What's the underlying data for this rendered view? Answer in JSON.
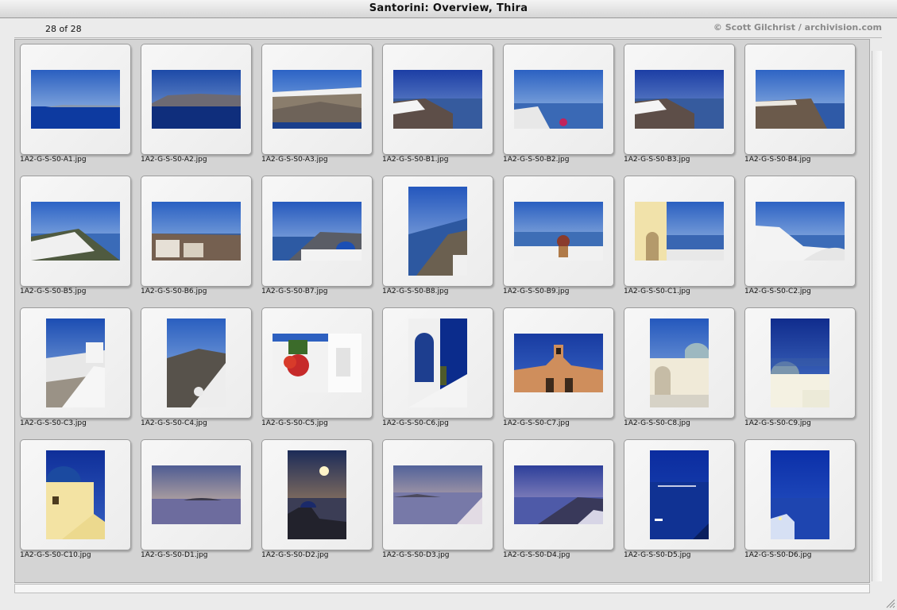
{
  "window": {
    "title": "Santorini: Overview, Thira",
    "counter": "28 of 28",
    "copyright": "© Scott Gilchrist / archivision.com"
  },
  "thumbnails": [
    {
      "filename": "1A2-G-S-S0-A1.jpg",
      "orientation": "landscape",
      "scene": "sea-horizon-island"
    },
    {
      "filename": "1A2-G-S-S0-A2.jpg",
      "orientation": "landscape",
      "scene": "caldera-cliffs-distant"
    },
    {
      "filename": "1A2-G-S-S0-A3.jpg",
      "orientation": "landscape",
      "scene": "town-on-cliff"
    },
    {
      "filename": "1A2-G-S-S0-B1.jpg",
      "orientation": "landscape",
      "scene": "village-caldera-view"
    },
    {
      "filename": "1A2-G-S-S0-B2.jpg",
      "orientation": "landscape",
      "scene": "terrace-flowers-sea"
    },
    {
      "filename": "1A2-G-S-S0-B3.jpg",
      "orientation": "landscape",
      "scene": "village-deep-blue-sky"
    },
    {
      "filename": "1A2-G-S-S0-B4.jpg",
      "orientation": "landscape",
      "scene": "cliff-town-sea"
    },
    {
      "filename": "1A2-G-S-S0-B5.jpg",
      "orientation": "landscape",
      "scene": "white-houses-slope"
    },
    {
      "filename": "1A2-G-S-S0-B6.jpg",
      "orientation": "landscape",
      "scene": "rooftops-caldera"
    },
    {
      "filename": "1A2-G-S-S0-B7.jpg",
      "orientation": "landscape",
      "scene": "blue-dome-church"
    },
    {
      "filename": "1A2-G-S-S0-B8.jpg",
      "orientation": "portrait",
      "scene": "cliffs-portrait"
    },
    {
      "filename": "1A2-G-S-S0-B9.jpg",
      "orientation": "landscape",
      "scene": "terrace-pot-plant"
    },
    {
      "filename": "1A2-G-S-S0-C1.jpg",
      "orientation": "landscape",
      "scene": "yellow-building-arch"
    },
    {
      "filename": "1A2-G-S-S0-C2.jpg",
      "orientation": "landscape",
      "scene": "white-roof-curve"
    },
    {
      "filename": "1A2-G-S-S0-C3.jpg",
      "orientation": "portrait",
      "scene": "white-stairs-houses"
    },
    {
      "filename": "1A2-G-S-S0-C4.jpg",
      "orientation": "portrait",
      "scene": "cliff-houses-portrait"
    },
    {
      "filename": "1A2-G-S-S0-C5.jpg",
      "orientation": "landscape",
      "scene": "red-flowers-white-walls"
    },
    {
      "filename": "1A2-G-S-S0-C6.jpg",
      "orientation": "portrait",
      "scene": "white-arch-doorway"
    },
    {
      "filename": "1A2-G-S-S0-C7.jpg",
      "orientation": "landscape",
      "scene": "bell-tower-facade"
    },
    {
      "filename": "1A2-G-S-S0-C8.jpg",
      "orientation": "portrait",
      "scene": "church-courtyard"
    },
    {
      "filename": "1A2-G-S-S0-C9.jpg",
      "orientation": "portrait",
      "scene": "blue-dome-chapel"
    },
    {
      "filename": "1A2-G-S-S0-C10.jpg",
      "orientation": "portrait",
      "scene": "yellow-church-dome"
    },
    {
      "filename": "1A2-G-S-S0-D1.jpg",
      "orientation": "landscape",
      "scene": "sunset-island"
    },
    {
      "filename": "1A2-G-S-S0-D2.jpg",
      "orientation": "portrait",
      "scene": "sunset-dome-silhouette"
    },
    {
      "filename": "1A2-G-S-S0-D3.jpg",
      "orientation": "landscape",
      "scene": "dusk-sea-village"
    },
    {
      "filename": "1A2-G-S-S0-D4.jpg",
      "orientation": "landscape",
      "scene": "twilight-cliff-lights"
    },
    {
      "filename": "1A2-G-S-S0-D5.jpg",
      "orientation": "portrait",
      "scene": "night-sea-boats"
    },
    {
      "filename": "1A2-G-S-S0-D6.jpg",
      "orientation": "portrait",
      "scene": "night-village-lights"
    }
  ]
}
